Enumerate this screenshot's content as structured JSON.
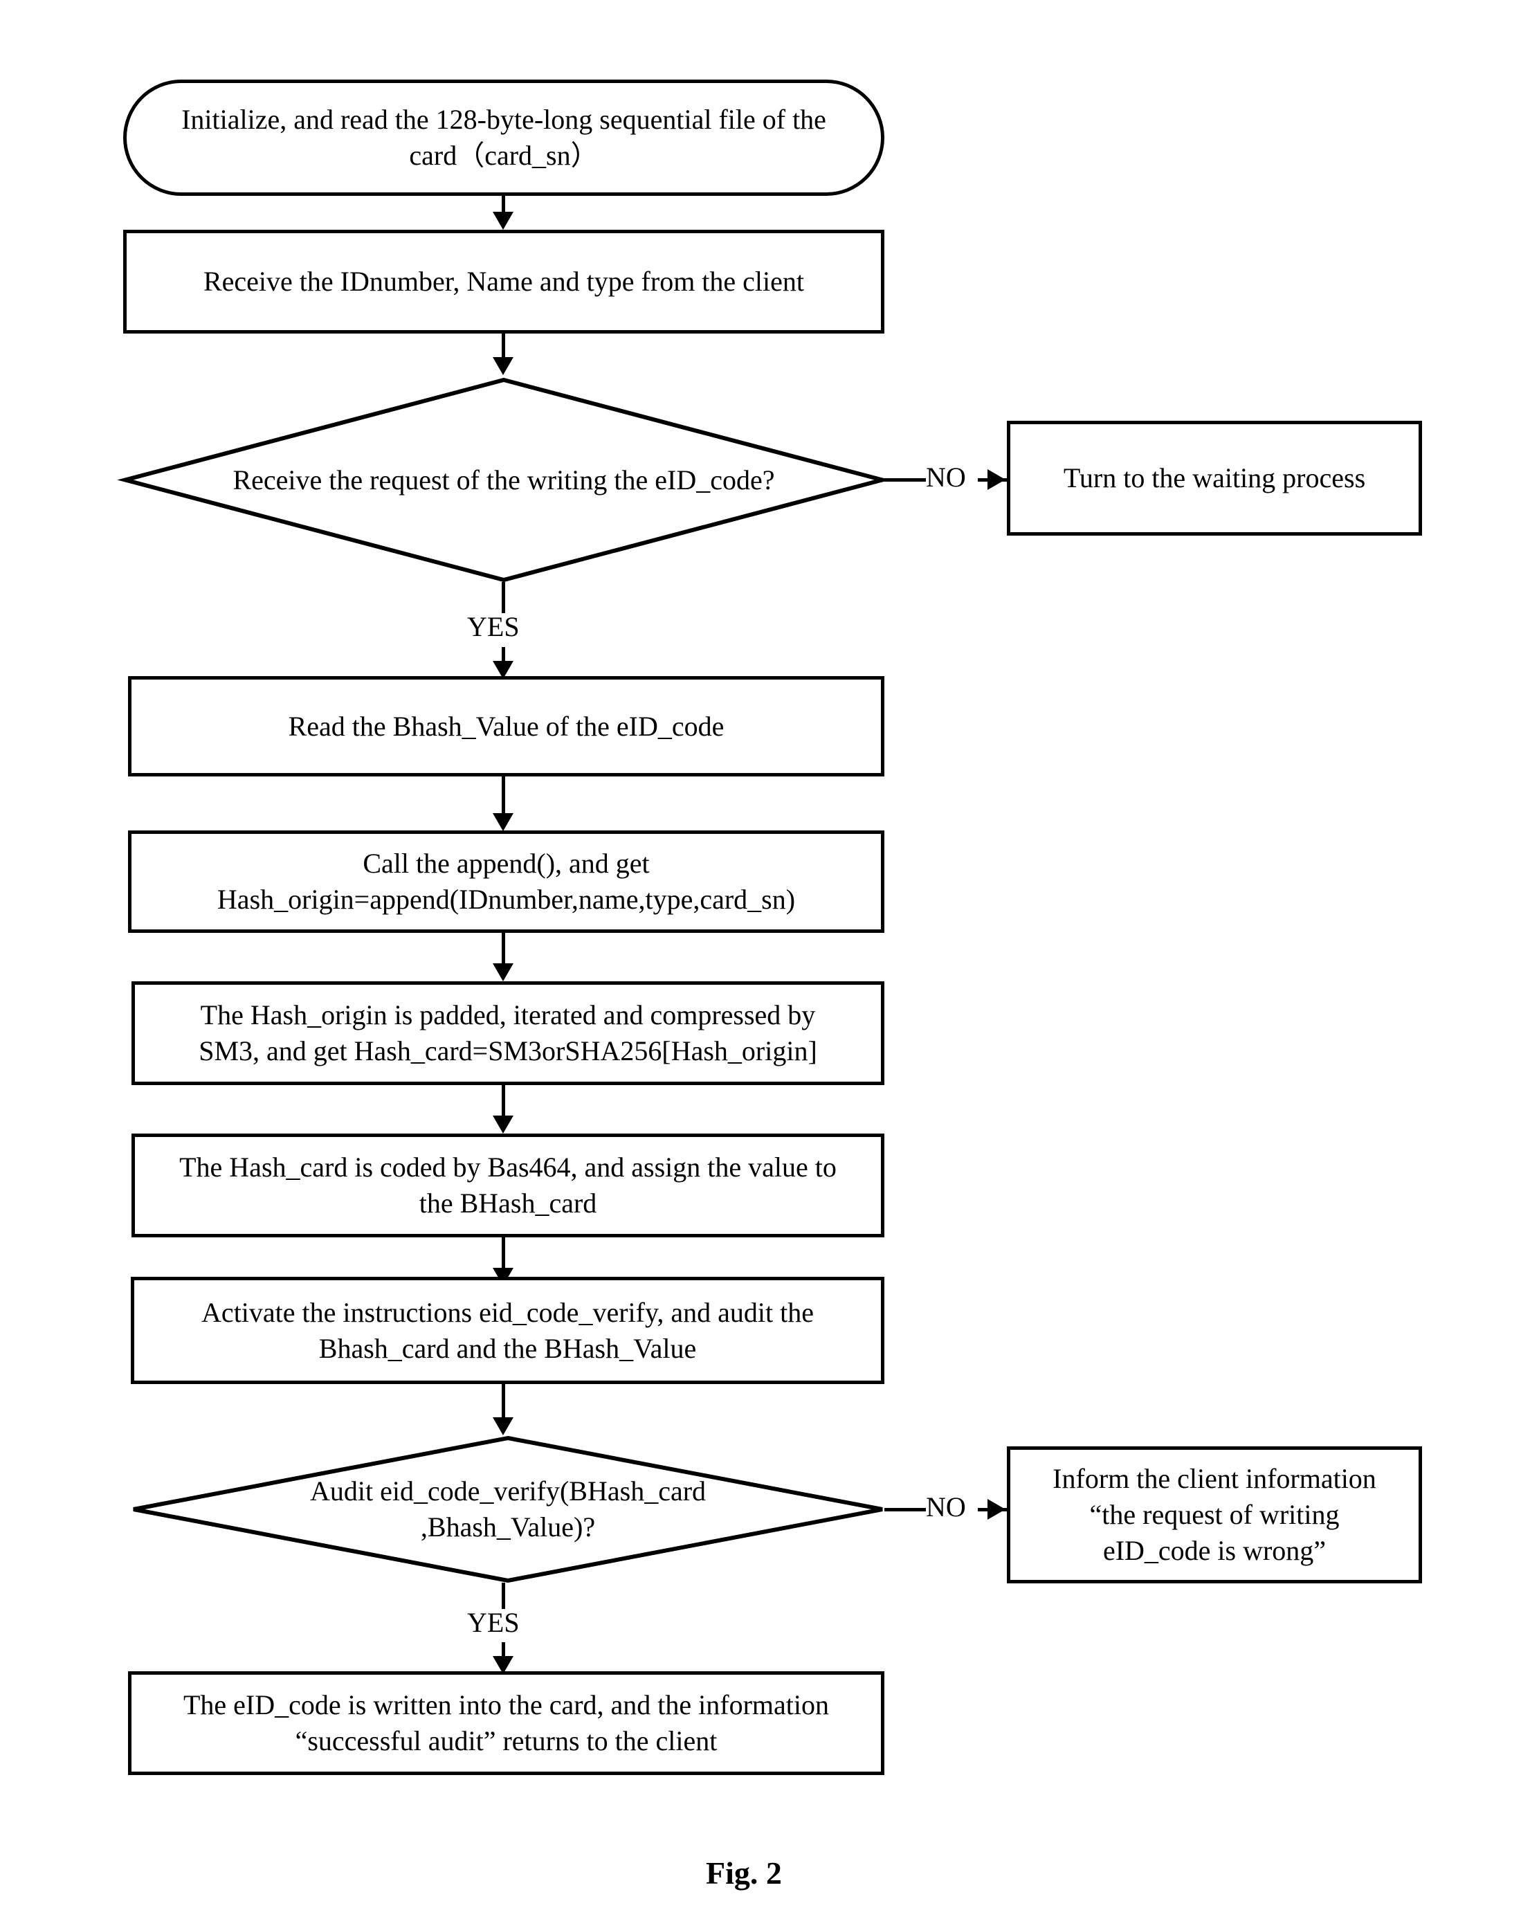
{
  "figure": {
    "caption": "Fig. 2"
  },
  "nodes": {
    "start": {
      "shape": "terminator",
      "text": "Initialize, and read the 128-byte-long sequential file of the\ncard（card_sn）"
    },
    "receive_client": {
      "shape": "process",
      "text": "Receive the IDnumber, Name and type from the client"
    },
    "decision_request": {
      "shape": "decision",
      "text": "Receive the request of the writing the eID_code?"
    },
    "waiting_process": {
      "shape": "process",
      "text": "Turn to the waiting process"
    },
    "read_bhash_value": {
      "shape": "process",
      "text": "Read the Bhash_Value of the  eID_code"
    },
    "call_append": {
      "shape": "process",
      "text": "Call the append(), and get\nHash_origin=append(IDnumber,name,type,card_sn)"
    },
    "sm3_compress": {
      "shape": "process",
      "text": "The Hash_origin is padded, iterated and compressed by\nSM3, and get Hash_card=SM3orSHA256[Hash_origin]"
    },
    "base64_encode": {
      "shape": "process",
      "text": "The Hash_card is coded by Bas464, and assign the value to\nthe BHash_card"
    },
    "activate_verify": {
      "shape": "process",
      "text": "Activate the instructions eid_code_verify, and audit the\nBhash_card and the BHash_Value"
    },
    "decision_audit": {
      "shape": "decision",
      "text": "Audit eid_code_verify(BHash_card\n,Bhash_Value)?"
    },
    "inform_wrong": {
      "shape": "process",
      "text": "Inform the client information\n“the request of writing\neID_code is wrong”"
    },
    "write_success": {
      "shape": "process",
      "text": "The eID_code is written into the card, and the information\n“successful audit” returns to the client"
    }
  },
  "edges": {
    "request_no": "NO",
    "request_yes": "YES",
    "audit_no": "NO",
    "audit_yes": "YES"
  },
  "style": {
    "stroke": "#000000",
    "fill": "#ffffff"
  }
}
